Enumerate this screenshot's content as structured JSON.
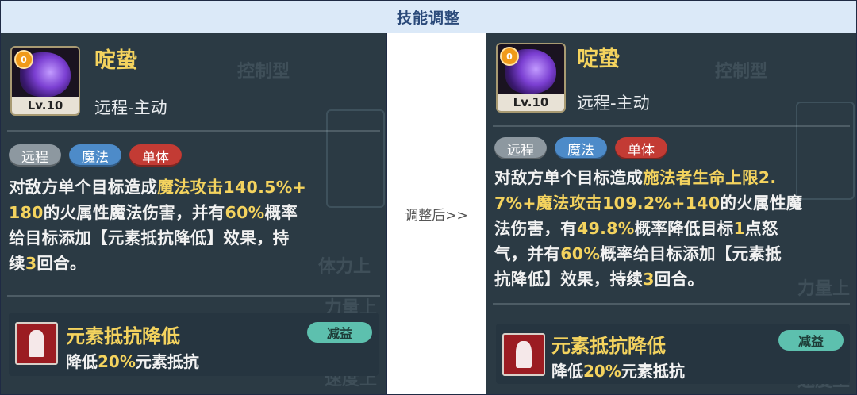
{
  "header": {
    "title": "技能调整"
  },
  "middle": {
    "label": "调整后>>"
  },
  "background_text": [
    "控制型",
    "体力上",
    "力量上",
    "速度上"
  ],
  "before": {
    "skill_name": "啶蛰",
    "badge": "0",
    "level": "Lv.10",
    "skill_type": "远程-主动",
    "tags": [
      "远程",
      "魔法",
      "单体"
    ],
    "desc_lines": [
      [
        {
          "t": "对敌方单个目标造成"
        },
        {
          "t": "魔法攻击140.5%+",
          "h": true
        }
      ],
      [
        {
          "t": "180",
          "h": true
        },
        {
          "t": "的火属性魔法伤害，并有"
        },
        {
          "t": "60%",
          "h": true
        },
        {
          "t": "概率"
        }
      ],
      [
        {
          "t": "给目标添加【元素抵抗降低】效果，持"
        }
      ],
      [
        {
          "t": "续"
        },
        {
          "t": "3",
          "h": true
        },
        {
          "t": "回合。"
        }
      ]
    ],
    "effect": {
      "name": "元素抵抗降低",
      "tag": "减益",
      "desc_prefix": "降低",
      "desc_value": "20%",
      "desc_suffix": "元素抵抗"
    }
  },
  "after": {
    "skill_name": "啶蛰",
    "badge": "0",
    "level": "Lv.10",
    "skill_type": "远程-主动",
    "tags": [
      "远程",
      "魔法",
      "单体"
    ],
    "desc_lines": [
      [
        {
          "t": "对敌方单个目标造成"
        },
        {
          "t": "施法者生命上限2.",
          "h": true
        }
      ],
      [
        {
          "t": "7%+魔法攻击109.2%+140",
          "h": true
        },
        {
          "t": "的火属性魔"
        }
      ],
      [
        {
          "t": "法伤害，有"
        },
        {
          "t": "49.8%",
          "h": true
        },
        {
          "t": "概率降低目标"
        },
        {
          "t": "1",
          "h": true
        },
        {
          "t": "点怒"
        }
      ],
      [
        {
          "t": "气，并有"
        },
        {
          "t": "60%",
          "h": true
        },
        {
          "t": "概率给目标添加【元素抵"
        }
      ],
      [
        {
          "t": "抗降低】效果，持续"
        },
        {
          "t": "3",
          "h": true
        },
        {
          "t": "回合。"
        }
      ]
    ],
    "effect": {
      "name": "元素抵抗降低",
      "tag": "减益",
      "desc_prefix": "降低",
      "desc_value": "20%",
      "desc_suffix": "元素抵抗"
    }
  },
  "colors": {
    "header_bg": "#dbe9f8",
    "header_text": "#2b4a7a",
    "card_bg": "#2b3a44",
    "highlight": "#f4d35e",
    "tag_ranged": "#8d98a0",
    "tag_magic": "#4d8bc9",
    "tag_single": "#c33b34",
    "debuff_tag": "#5dc0ae"
  }
}
